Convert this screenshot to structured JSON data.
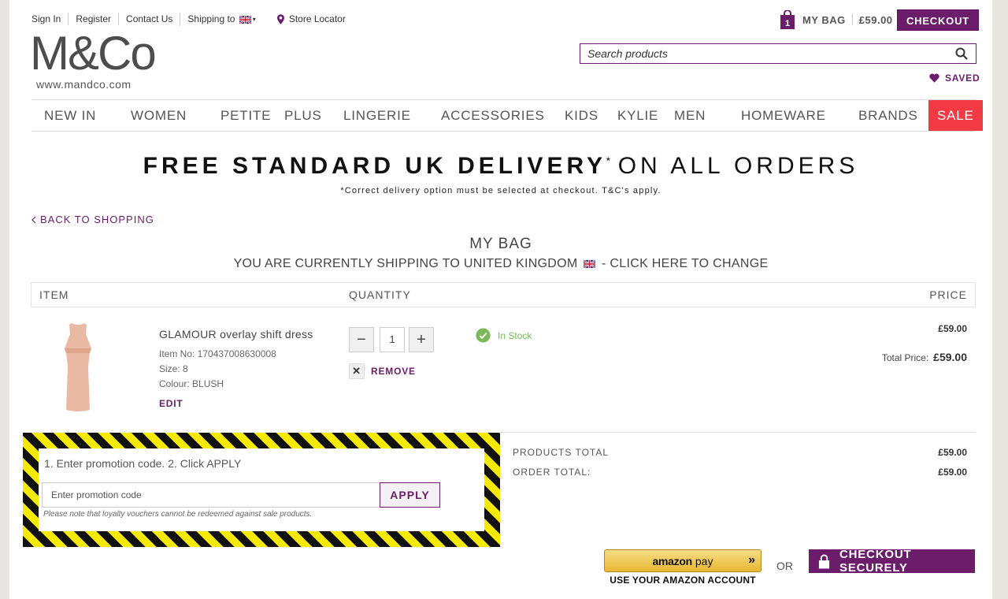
{
  "header": {
    "top_links": [
      "Sign In",
      "Register",
      "Contact Us",
      "Shipping to"
    ],
    "store_locator": "Store Locator",
    "logo_text": "M&Co",
    "logo_url": "www.mandco.com",
    "bag_count": "1",
    "bag_label": "MY BAG",
    "bag_price": "£59.00",
    "checkout_label": "CHECKOUT",
    "search_placeholder": "Search products",
    "saved_label": "SAVED"
  },
  "nav": [
    "NEW IN",
    "WOMEN",
    "PETITE",
    "PLUS",
    "LINGERIE",
    "ACCESSORIES",
    "KIDS",
    "KYLIE",
    "MEN",
    "HOMEWARE",
    "BRANDS",
    "SALE"
  ],
  "banner": {
    "bold": "FREE STANDARD UK DELIVERY",
    "asterisk": "*",
    "light": "ON ALL ORDERS",
    "note": "*Correct delivery option must be selected at checkout. T&C's apply."
  },
  "back_label": "BACK TO SHOPPING",
  "bag_title": "MY BAG",
  "shipping_text_1": "YOU ARE CURRENTLY SHIPPING TO UNITED KINGDOM",
  "shipping_text_2": "- CLICK HERE TO CHANGE",
  "table": {
    "col_item": "ITEM",
    "col_quantity": "QUANTITY",
    "col_price": "PRICE"
  },
  "product": {
    "name": "GLAMOUR overlay shift dress",
    "item_no": "Item No: 170437008630008",
    "size": "Size: 8",
    "colour": "Colour: BLUSH",
    "edit": "EDIT",
    "quantity": "1",
    "minus": "−",
    "plus": "+",
    "remove": "REMOVE",
    "stock": "In Stock",
    "price": "£59.00",
    "total_label": "Total Price:",
    "total_value": "£59.00"
  },
  "promo": {
    "title": "1. Enter promotion code. 2. Click APPLY",
    "placeholder": "Enter promotion code",
    "apply": "APPLY",
    "note": "Please note that loyalty vouchers cannot be redeemed against sale products."
  },
  "totals": {
    "products_label": "PRODUCTS TOTAL",
    "products_value": "£59.00",
    "order_label": "ORDER TOTAL:",
    "order_value": "£59.00"
  },
  "payment": {
    "amazon_word": "amazon",
    "amazon_pay": "pay",
    "amazon_arrows": "»",
    "amazon_sub": "USE YOUR AMAZON ACCOUNT",
    "or": "OR",
    "secure": "CHECKOUT SECURELY"
  },
  "colors": {
    "brand": "#6b1c6b",
    "sale": "#f23a44",
    "stock": "#7ab85a"
  }
}
